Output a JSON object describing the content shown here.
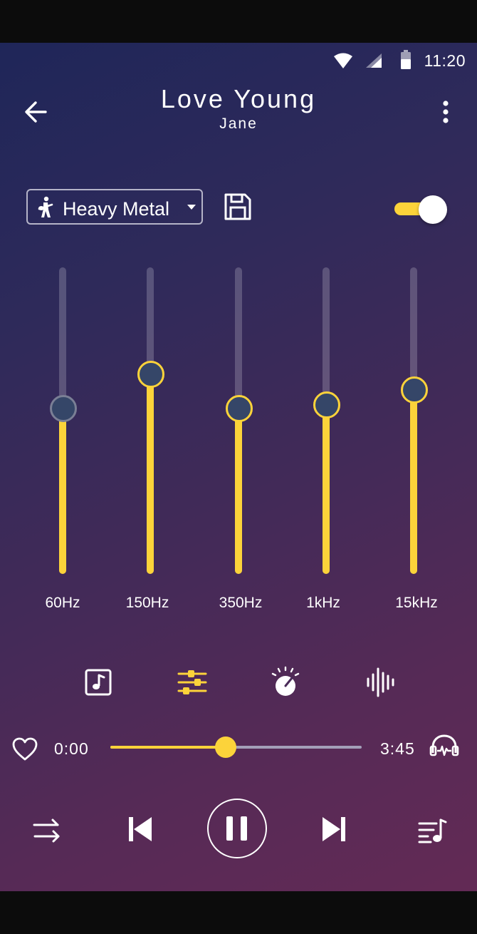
{
  "status_bar": {
    "time": "11:20"
  },
  "header": {
    "title": "Love Young",
    "artist": "Jane"
  },
  "preset": {
    "selected": "Heavy Metal"
  },
  "equalizer_enabled": true,
  "equalizer": {
    "bands": [
      {
        "label": "60Hz",
        "level": 0.54
      },
      {
        "label": "150Hz",
        "level": 0.65
      },
      {
        "label": "350Hz",
        "level": 0.54
      },
      {
        "label": "1kHz",
        "level": 0.55
      },
      {
        "label": "15kHz",
        "level": 0.6
      }
    ]
  },
  "tools": [
    "music-note-icon",
    "equalizer-sliders-icon",
    "speed-dial-icon",
    "sound-wave-icon"
  ],
  "player": {
    "elapsed": "0:00",
    "duration": "3:45",
    "progress": 0.46
  },
  "colors": {
    "accent": "#fcd33a",
    "knob": "#354668"
  }
}
